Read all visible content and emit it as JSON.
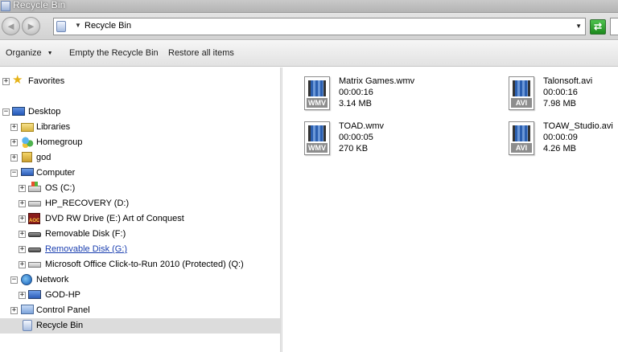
{
  "window": {
    "title": "Recycle Bin"
  },
  "navigation": {
    "back_icon": "back-arrow-icon",
    "forward_icon": "forward-arrow-icon",
    "address": "Recycle Bin",
    "refresh_icon": "refresh-icon"
  },
  "toolbar": {
    "organize_label": "Organize",
    "empty_label": "Empty the Recycle Bin",
    "restore_label": "Restore all items"
  },
  "tree": [
    {
      "label": "Favorites",
      "icon": "star-icon",
      "expander": "+"
    },
    {
      "label": "Desktop",
      "icon": "desktop-icon",
      "expander": "−"
    },
    {
      "label": "Libraries",
      "icon": "libraries-icon",
      "expander": "+"
    },
    {
      "label": "Homegroup",
      "icon": "homegroup-icon",
      "expander": "+"
    },
    {
      "label": "god",
      "icon": "user-folder-icon",
      "expander": "+"
    },
    {
      "label": "Computer",
      "icon": "computer-icon",
      "expander": "−"
    },
    {
      "label": "OS (C:)",
      "icon": "os-drive-icon",
      "expander": "+"
    },
    {
      "label": "HP_RECOVERY (D:)",
      "icon": "hard-drive-icon",
      "expander": "+"
    },
    {
      "label": "DVD RW Drive (E:) Art of Conquest",
      "icon": "dvd-drive-icon",
      "expander": "+"
    },
    {
      "label": "Removable Disk (F:)",
      "icon": "removable-disk-icon",
      "expander": "+"
    },
    {
      "label": "Removable Disk (G:)",
      "icon": "removable-disk-icon",
      "expander": "+"
    },
    {
      "label": "Microsoft Office Click-to-Run 2010 (Protected) (Q:)",
      "icon": "office-drive-icon",
      "expander": "+"
    },
    {
      "label": "Network",
      "icon": "network-icon",
      "expander": "−"
    },
    {
      "label": "GOD-HP",
      "icon": "network-computer-icon",
      "expander": "+"
    },
    {
      "label": "Control Panel",
      "icon": "control-panel-icon",
      "expander": "+"
    },
    {
      "label": "Recycle Bin",
      "icon": "recycle-bin-icon",
      "expander": ""
    }
  ],
  "files": [
    {
      "name": "Matrix Games.wmv",
      "duration": "00:00:16",
      "size": "3.14 MB",
      "ext": "WMV"
    },
    {
      "name": "Talonsoft.avi",
      "duration": "00:00:16",
      "size": "7.98 MB",
      "ext": "AVI"
    },
    {
      "name": "TOAD.wmv",
      "duration": "00:00:05",
      "size": "270 KB",
      "ext": "WMV"
    },
    {
      "name": "TOAW_Studio.avi",
      "duration": "00:00:09",
      "size": "4.26 MB",
      "ext": "AVI"
    }
  ]
}
